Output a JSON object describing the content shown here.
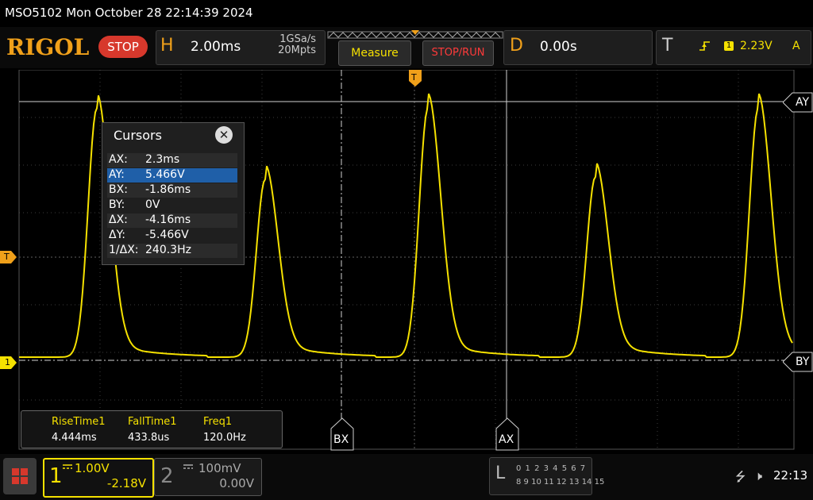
{
  "title_bar": {
    "text": "MSO5102  Mon October 28 22:14:39 2024"
  },
  "header": {
    "logo": "RIGOL",
    "run_state": "STOP",
    "horizontal": {
      "letter": "H",
      "timebase": "2.00ms",
      "sample_rate": "1GSa/s",
      "memory_depth": "20Mpts"
    },
    "measure_label": "Measure",
    "stop_run_label": "STOP/RUN",
    "delay": {
      "letter": "D",
      "value": "0.00s"
    },
    "trigger": {
      "letter": "T",
      "icon": "rising-edge-icon",
      "channel": "1",
      "level": "2.23V",
      "mode": "A"
    }
  },
  "markers": {
    "trigger_level": "T",
    "channel1_ground": "1",
    "trigger_position": "T"
  },
  "cursor_labels": {
    "ay": "AY",
    "by": "BY",
    "bx": "BX",
    "ax": "AX"
  },
  "cursor_panel": {
    "title": "Cursors",
    "close_icon": "close-icon",
    "rows": [
      {
        "key": "AX:",
        "value": "2.3ms"
      },
      {
        "key": "AY:",
        "value": "5.466V"
      },
      {
        "key": "BX:",
        "value": "-1.86ms"
      },
      {
        "key": "BY:",
        "value": "0V"
      },
      {
        "key": "ΔX:",
        "value": "-4.16ms"
      },
      {
        "key": "ΔY:",
        "value": "-5.466V"
      },
      {
        "key": "1/ΔX:",
        "value": "240.3Hz"
      }
    ],
    "selected_row": 1
  },
  "measurements": [
    {
      "label": "RiseTime1",
      "value": "4.444ms"
    },
    {
      "label": "FallTime1",
      "value": "433.8us"
    },
    {
      "label": "Freq1",
      "value": "120.0Hz"
    }
  ],
  "channels": [
    {
      "number": "1",
      "scale": "1.00V",
      "offset": "-2.18V",
      "active": true
    },
    {
      "number": "2",
      "scale": "100mV",
      "offset": "0.00V",
      "active": false
    }
  ],
  "logic": {
    "letter": "L",
    "row1": "0 1 2 3  4 5 6 7",
    "row2": "8 9 10 11 12 13 14 15"
  },
  "status": {
    "usb_icon": "usb-icon",
    "mute_icon": "speaker-mute-icon",
    "time": "22:13"
  },
  "colors": {
    "ch1": "#f5e100",
    "accent": "#f0a01a",
    "stop": "#d7382c"
  }
}
